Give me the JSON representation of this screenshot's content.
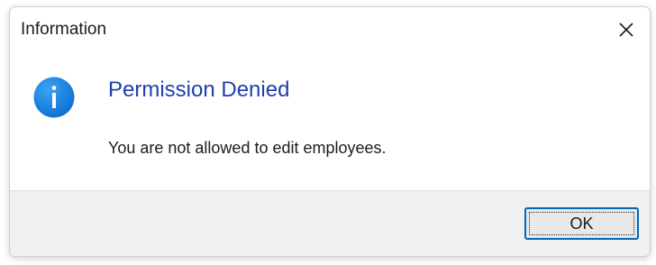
{
  "dialog": {
    "title": "Information",
    "close_icon": "close-icon",
    "icon": "info-icon",
    "heading": "Permission Denied",
    "message": "You are not allowed to edit employees.",
    "ok_label": "OK",
    "colors": {
      "heading": "#1f3fae",
      "icon_blue": "#1a86e8",
      "footer_bg": "#f0f0f0",
      "ok_border": "#0067c0"
    }
  }
}
